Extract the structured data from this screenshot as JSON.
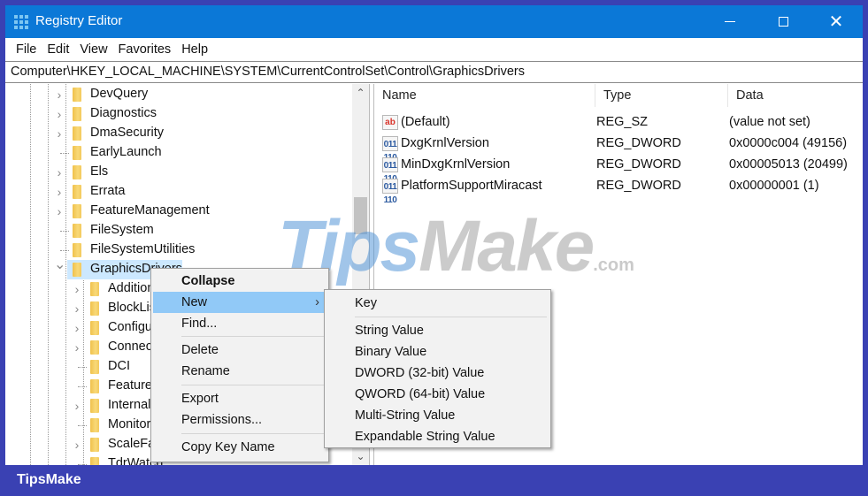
{
  "window": {
    "title": "Registry Editor",
    "controls": {
      "minimize": "minimize",
      "maximize": "maximize",
      "close": "✕"
    }
  },
  "menu": [
    "File",
    "Edit",
    "View",
    "Favorites",
    "Help"
  ],
  "address": "Computer\\HKEY_LOCAL_MACHINE\\SYSTEM\\CurrentControlSet\\Control\\GraphicsDrivers",
  "tree": {
    "items": [
      {
        "label": "DevQuery",
        "expandable": true,
        "level": 1
      },
      {
        "label": "Diagnostics",
        "expandable": true,
        "level": 1
      },
      {
        "label": "DmaSecurity",
        "expandable": true,
        "level": 1
      },
      {
        "label": "EarlyLaunch",
        "expandable": false,
        "level": 1
      },
      {
        "label": "Els",
        "expandable": true,
        "level": 1
      },
      {
        "label": "Errata",
        "expandable": true,
        "level": 1
      },
      {
        "label": "FeatureManagement",
        "expandable": true,
        "level": 1
      },
      {
        "label": "FileSystem",
        "expandable": false,
        "level": 1
      },
      {
        "label": "FileSystemUtilities",
        "expandable": false,
        "level": 1
      },
      {
        "label": "GraphicsDrivers",
        "expandable": true,
        "expanded": true,
        "selected": true,
        "level": 1
      },
      {
        "label": "AdditionalModeLists",
        "expandable": true,
        "level": 2
      },
      {
        "label": "BlockList",
        "expandable": true,
        "level": 2
      },
      {
        "label": "Configuration",
        "expandable": true,
        "level": 2
      },
      {
        "label": "Connectivity",
        "expandable": true,
        "level": 2
      },
      {
        "label": "DCI",
        "expandable": false,
        "level": 2
      },
      {
        "label": "FeatureSetUsage",
        "expandable": false,
        "level": 2
      },
      {
        "label": "InternalMonRes",
        "expandable": true,
        "level": 2
      },
      {
        "label": "MonitorDataStore",
        "expandable": false,
        "level": 2
      },
      {
        "label": "ScaleFactors",
        "expandable": true,
        "level": 2
      },
      {
        "label": "TdrWatch",
        "expandable": false,
        "level": 2
      }
    ],
    "scroll_up": "^",
    "scroll_down": "v"
  },
  "values": {
    "columns": [
      "Name",
      "Type",
      "Data"
    ],
    "rows": [
      {
        "icon": "string-value-icon",
        "icon_text": "ab",
        "name": "(Default)",
        "type": "REG_SZ",
        "data": "(value not set)"
      },
      {
        "icon": "binary-value-icon",
        "icon_text": "011 110",
        "name": "DxgKrnlVersion",
        "type": "REG_DWORD",
        "data": "0x0000c004 (49156)"
      },
      {
        "icon": "binary-value-icon",
        "icon_text": "011 110",
        "name": "MinDxgKrnlVersion",
        "type": "REG_DWORD",
        "data": "0x00005013 (20499)"
      },
      {
        "icon": "binary-value-icon",
        "icon_text": "011 110",
        "name": "PlatformSupportMiracast",
        "type": "REG_DWORD",
        "data": "0x00000001 (1)"
      }
    ]
  },
  "context_menu": {
    "items": [
      "Collapse",
      "New",
      "Find...",
      "Delete",
      "Rename",
      "Export",
      "Permissions...",
      "Copy Key Name"
    ],
    "submenu_arrow": "›"
  },
  "submenu": {
    "items": [
      "Key",
      "String Value",
      "Binary Value",
      "DWORD (32-bit) Value",
      "QWORD (64-bit) Value",
      "Multi-String Value",
      "Expandable String Value"
    ]
  },
  "watermark": {
    "part1": "Tips",
    "part2": "Make",
    "part3": ".com"
  },
  "footer": {
    "brand": "TipsMake"
  },
  "colors": {
    "titlebar": "#0b78d7",
    "frame": "#3a41b3",
    "selection": "#cce8ff",
    "menu_highlight": "#91c9f7"
  }
}
